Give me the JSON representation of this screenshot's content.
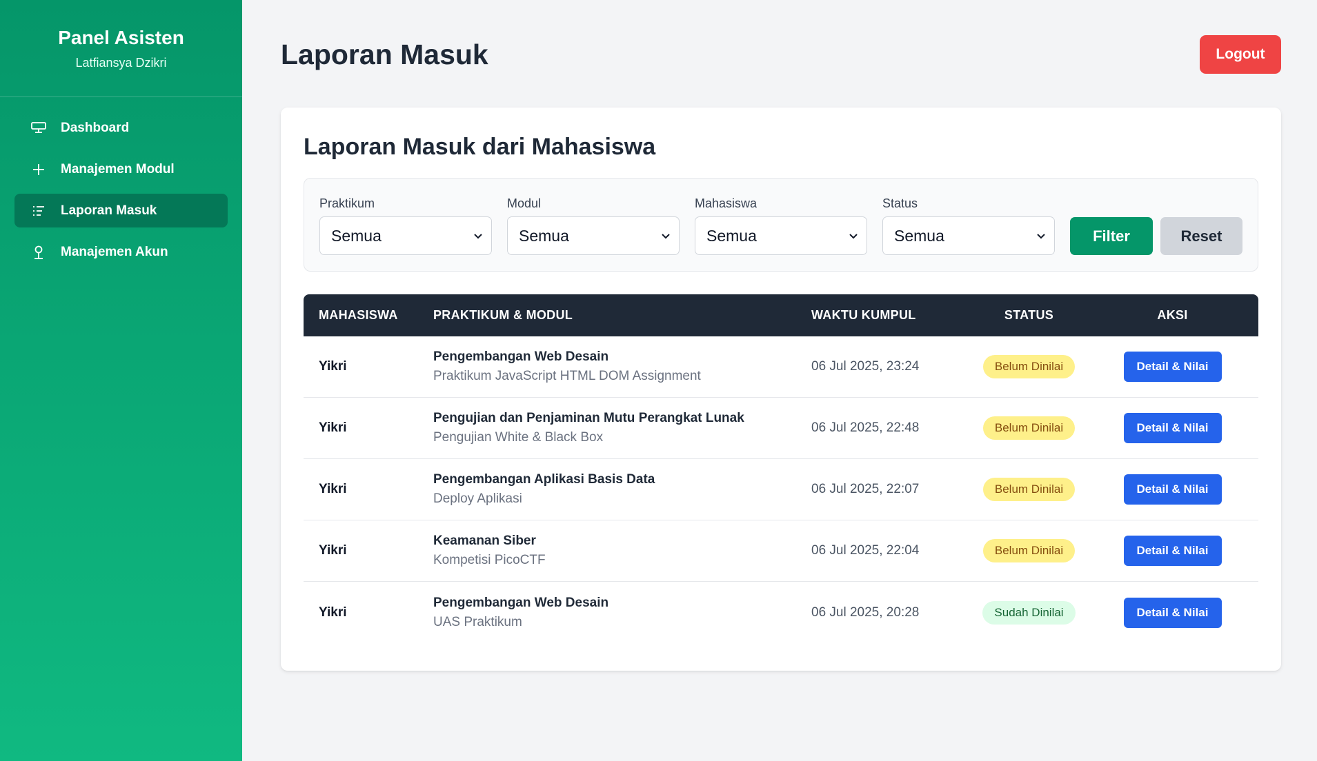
{
  "sidebar": {
    "title": "Panel Asisten",
    "user": "Latfiansya Dzikri",
    "items": [
      {
        "label": "Dashboard",
        "icon": "monitor-icon",
        "active": false
      },
      {
        "label": "Manajemen Modul",
        "icon": "plus-icon",
        "active": false
      },
      {
        "label": "Laporan Masuk",
        "icon": "list-icon",
        "active": true
      },
      {
        "label": "Manajemen Akun",
        "icon": "user-icon",
        "active": false
      }
    ]
  },
  "header": {
    "title": "Laporan Masuk",
    "logout_label": "Logout"
  },
  "card": {
    "title": "Laporan Masuk dari Mahasiswa"
  },
  "filters": {
    "praktikum": {
      "label": "Praktikum",
      "value": "Semua"
    },
    "modul": {
      "label": "Modul",
      "value": "Semua"
    },
    "mahasiswa": {
      "label": "Mahasiswa",
      "value": "Semua"
    },
    "status": {
      "label": "Status",
      "value": "Semua"
    },
    "filter_label": "Filter",
    "reset_label": "Reset"
  },
  "table": {
    "columns": {
      "mahasiswa": "MAHASISWA",
      "praktikum": "PRAKTIKUM & MODUL",
      "waktu": "WAKTU KUMPUL",
      "status": "STATUS",
      "aksi": "AKSI"
    },
    "rows": [
      {
        "mahasiswa": "Yikri",
        "praktikum": "Pengembangan Web Desain",
        "modul": "Praktikum JavaScript HTML DOM Assignment",
        "waktu": "06 Jul 2025, 23:24",
        "status": "Belum Dinilai",
        "action": "Detail & Nilai"
      },
      {
        "mahasiswa": "Yikri",
        "praktikum": "Pengujian dan Penjaminan Mutu Perangkat Lunak",
        "modul": "Pengujian White & Black Box",
        "waktu": "06 Jul 2025, 22:48",
        "status": "Belum Dinilai",
        "action": "Detail & Nilai"
      },
      {
        "mahasiswa": "Yikri",
        "praktikum": "Pengembangan Aplikasi Basis Data",
        "modul": "Deploy Aplikasi",
        "waktu": "06 Jul 2025, 22:07",
        "status": "Belum Dinilai",
        "action": "Detail & Nilai"
      },
      {
        "mahasiswa": "Yikri",
        "praktikum": "Keamanan Siber",
        "modul": "Kompetisi PicoCTF",
        "waktu": "06 Jul 2025, 22:04",
        "status": "Belum Dinilai",
        "action": "Detail & Nilai"
      },
      {
        "mahasiswa": "Yikri",
        "praktikum": "Pengembangan Web Desain",
        "modul": "UAS Praktikum",
        "waktu": "06 Jul 2025, 20:28",
        "status": "Sudah Dinilai",
        "action": "Detail & Nilai"
      }
    ]
  },
  "colors": {
    "sidebar_top": "#059669",
    "sidebar_bottom": "#10b981",
    "active_nav": "#047857",
    "logout": "#ef4444",
    "filter_button": "#059669",
    "detail_button": "#2563eb",
    "table_header": "#1f2937",
    "badge_pending": "#fef08a",
    "badge_done": "#dcfce7"
  }
}
